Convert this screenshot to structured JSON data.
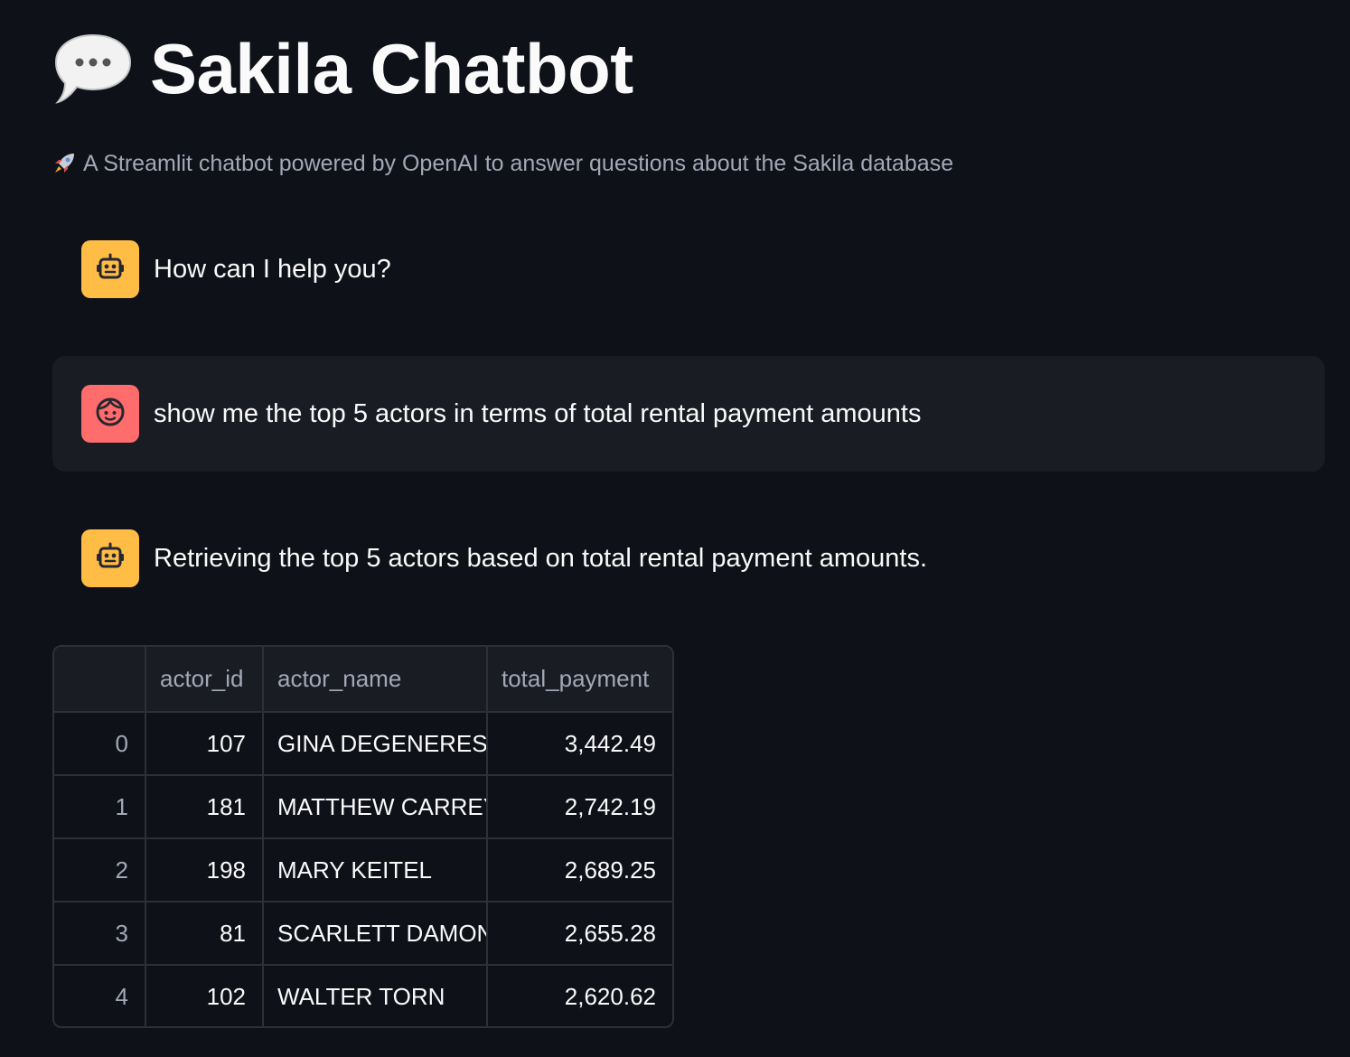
{
  "header": {
    "title": "Sakila Chatbot",
    "title_icon": "speech-balloon-icon",
    "caption": "A Streamlit chatbot powered by OpenAI to answer questions about the Sakila database",
    "caption_icon": "rocket-icon"
  },
  "colors": {
    "background": "#0e1117",
    "user_message_bg": "#1a1c24",
    "assistant_avatar": "#ffbd45",
    "user_avatar": "#ff6c6c"
  },
  "messages": [
    {
      "role": "assistant",
      "avatar_icon": "robot-icon",
      "text": "How can I help you?"
    },
    {
      "role": "user",
      "avatar_icon": "face-icon",
      "text": "show me the top 5 actors in terms of total rental payment amounts"
    },
    {
      "role": "assistant",
      "avatar_icon": "robot-icon",
      "text": "Retrieving the top 5 actors based on total rental payment amounts."
    }
  ],
  "dataframe": {
    "columns": [
      "",
      "actor_id",
      "actor_name",
      "total_payment"
    ],
    "rows": [
      [
        "0",
        "107",
        "GINA DEGENERES",
        "3,442.49"
      ],
      [
        "1",
        "181",
        "MATTHEW CARREY",
        "2,742.19"
      ],
      [
        "2",
        "198",
        "MARY KEITEL",
        "2,689.25"
      ],
      [
        "3",
        "81",
        "SCARLETT DAMON",
        "2,655.28"
      ],
      [
        "4",
        "102",
        "WALTER TORN",
        "2,620.62"
      ]
    ]
  }
}
